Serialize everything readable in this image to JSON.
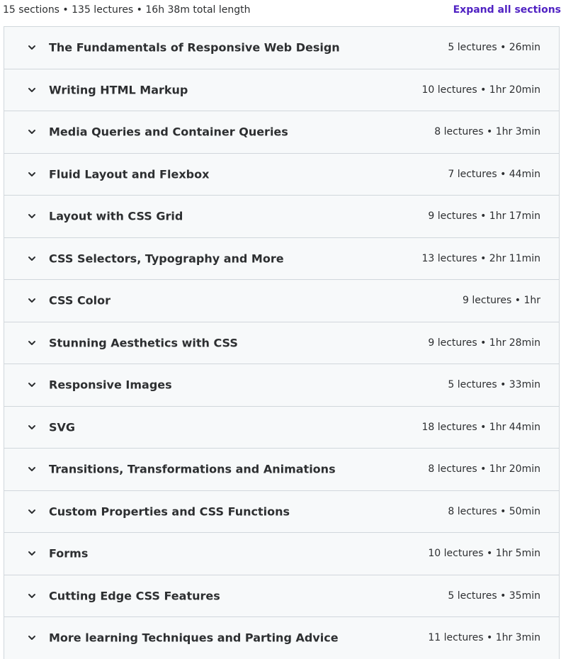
{
  "summary": {
    "text": "15 sections • 135 lectures • 16h 38m total length",
    "expand_label": "Expand all sections"
  },
  "colors": {
    "accent": "#5022c3",
    "row_bg": "#f7f9fa",
    "border": "#d1d7dc",
    "text": "#2d2f31"
  },
  "sections": [
    {
      "title": "The Fundamentals of Responsive Web Design",
      "meta": "5 lectures • 26min",
      "icon": "chevron-down-icon"
    },
    {
      "title": "Writing HTML Markup",
      "meta": "10 lectures • 1hr 20min",
      "icon": "chevron-down-icon"
    },
    {
      "title": "Media Queries and Container Queries",
      "meta": "8 lectures • 1hr 3min",
      "icon": "chevron-down-icon"
    },
    {
      "title": "Fluid Layout and Flexbox",
      "meta": "7 lectures • 44min",
      "icon": "chevron-down-icon"
    },
    {
      "title": "Layout with CSS Grid",
      "meta": "9 lectures • 1hr 17min",
      "icon": "chevron-down-icon"
    },
    {
      "title": "CSS Selectors, Typography and More",
      "meta": "13 lectures • 2hr 11min",
      "icon": "chevron-down-icon"
    },
    {
      "title": "CSS Color",
      "meta": "9 lectures • 1hr",
      "icon": "chevron-down-icon"
    },
    {
      "title": "Stunning Aesthetics with CSS",
      "meta": "9 lectures • 1hr 28min",
      "icon": "chevron-down-icon"
    },
    {
      "title": "Responsive Images",
      "meta": "5 lectures • 33min",
      "icon": "chevron-down-icon"
    },
    {
      "title": "SVG",
      "meta": "18 lectures • 1hr 44min",
      "icon": "chevron-down-icon"
    },
    {
      "title": "Transitions, Transformations and Animations",
      "meta": "8 lectures • 1hr 20min",
      "icon": "chevron-down-icon"
    },
    {
      "title": "Custom Properties and CSS Functions",
      "meta": "8 lectures • 50min",
      "icon": "chevron-down-icon"
    },
    {
      "title": "Forms",
      "meta": "10 lectures • 1hr 5min",
      "icon": "chevron-down-icon"
    },
    {
      "title": "Cutting Edge CSS Features",
      "meta": "5 lectures • 35min",
      "icon": "chevron-down-icon"
    },
    {
      "title": "More learning Techniques and Parting Advice",
      "meta": "11 lectures • 1hr 3min",
      "icon": "chevron-down-icon"
    }
  ]
}
